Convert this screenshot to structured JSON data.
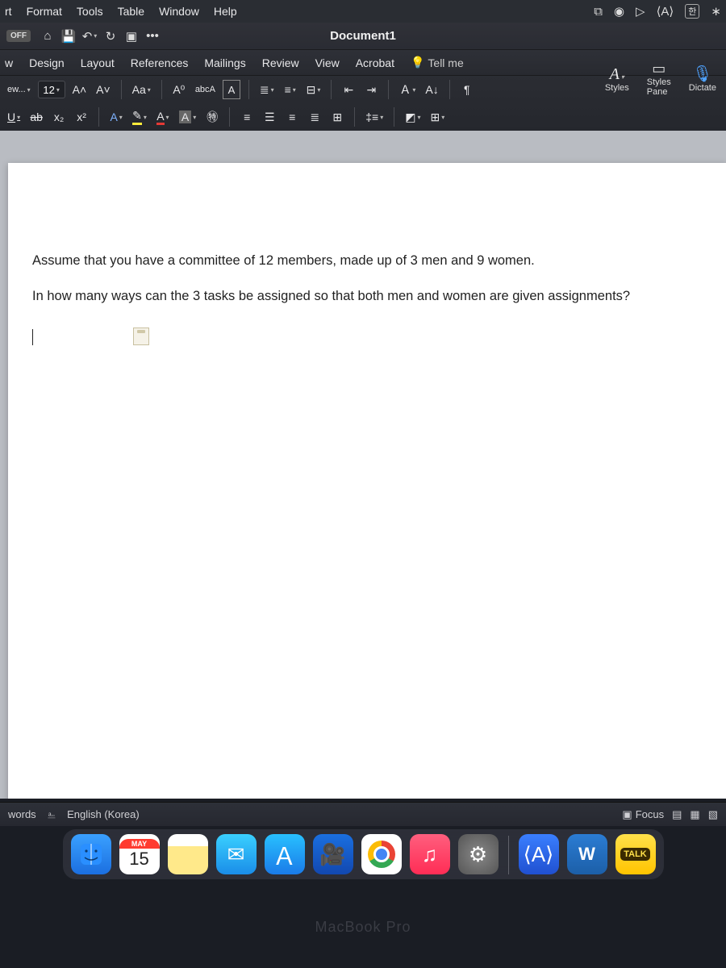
{
  "menubar": {
    "items": [
      "rt",
      "Format",
      "Tools",
      "Table",
      "Window",
      "Help"
    ],
    "right_icons": [
      "dropbox-icon",
      "wifi-icon",
      "play-icon",
      "translate-icon",
      "ime-icon",
      "bluetooth-icon"
    ],
    "ime_label": "한"
  },
  "titlebar": {
    "autosave_label": "OFF",
    "doc_title": "Document1",
    "quick_icons": [
      "home-icon",
      "save-icon",
      "undo-icon",
      "redo-icon",
      "print-icon",
      "more-icon"
    ],
    "more_label": "•••"
  },
  "tabs": {
    "items": [
      "w",
      "Design",
      "Layout",
      "References",
      "Mailings",
      "Review",
      "View",
      "Acrobat"
    ],
    "tell_me": "Tell me"
  },
  "ribbon": {
    "font_family_trunc": "ew...",
    "font_size": "12",
    "grow_label": "A˄",
    "shrink_label": "A˅",
    "case_label": "Aa",
    "clear_label": "A⁰",
    "phonetic_label": "abc",
    "char_border_label": "A",
    "styles_A": "A",
    "styles_label": "Styles",
    "styles_pane_label": "Styles\nPane",
    "dictate_label": "Dictate",
    "row2": {
      "underline": "U",
      "strike": "ab",
      "sub": "x₂",
      "sup": "x²",
      "texteffects": "A",
      "highlight": "✎",
      "fontcolor": "A",
      "shading": "A",
      "enclose": "㊕"
    }
  },
  "document": {
    "p1": "Assume that you have a committee of 12 members, made up of 3 men and 9 women.",
    "p2": "In how many ways can the 3 tasks be assigned so that both men and women are given assignments?"
  },
  "status": {
    "words": "words",
    "lang": "English (Korea)",
    "focus": "Focus"
  },
  "dock": {
    "cal_month": "MAY",
    "cal_day": "15",
    "word_letter": "W",
    "talk_label": "TALK"
  },
  "laptop_label": "MacBook Pro"
}
